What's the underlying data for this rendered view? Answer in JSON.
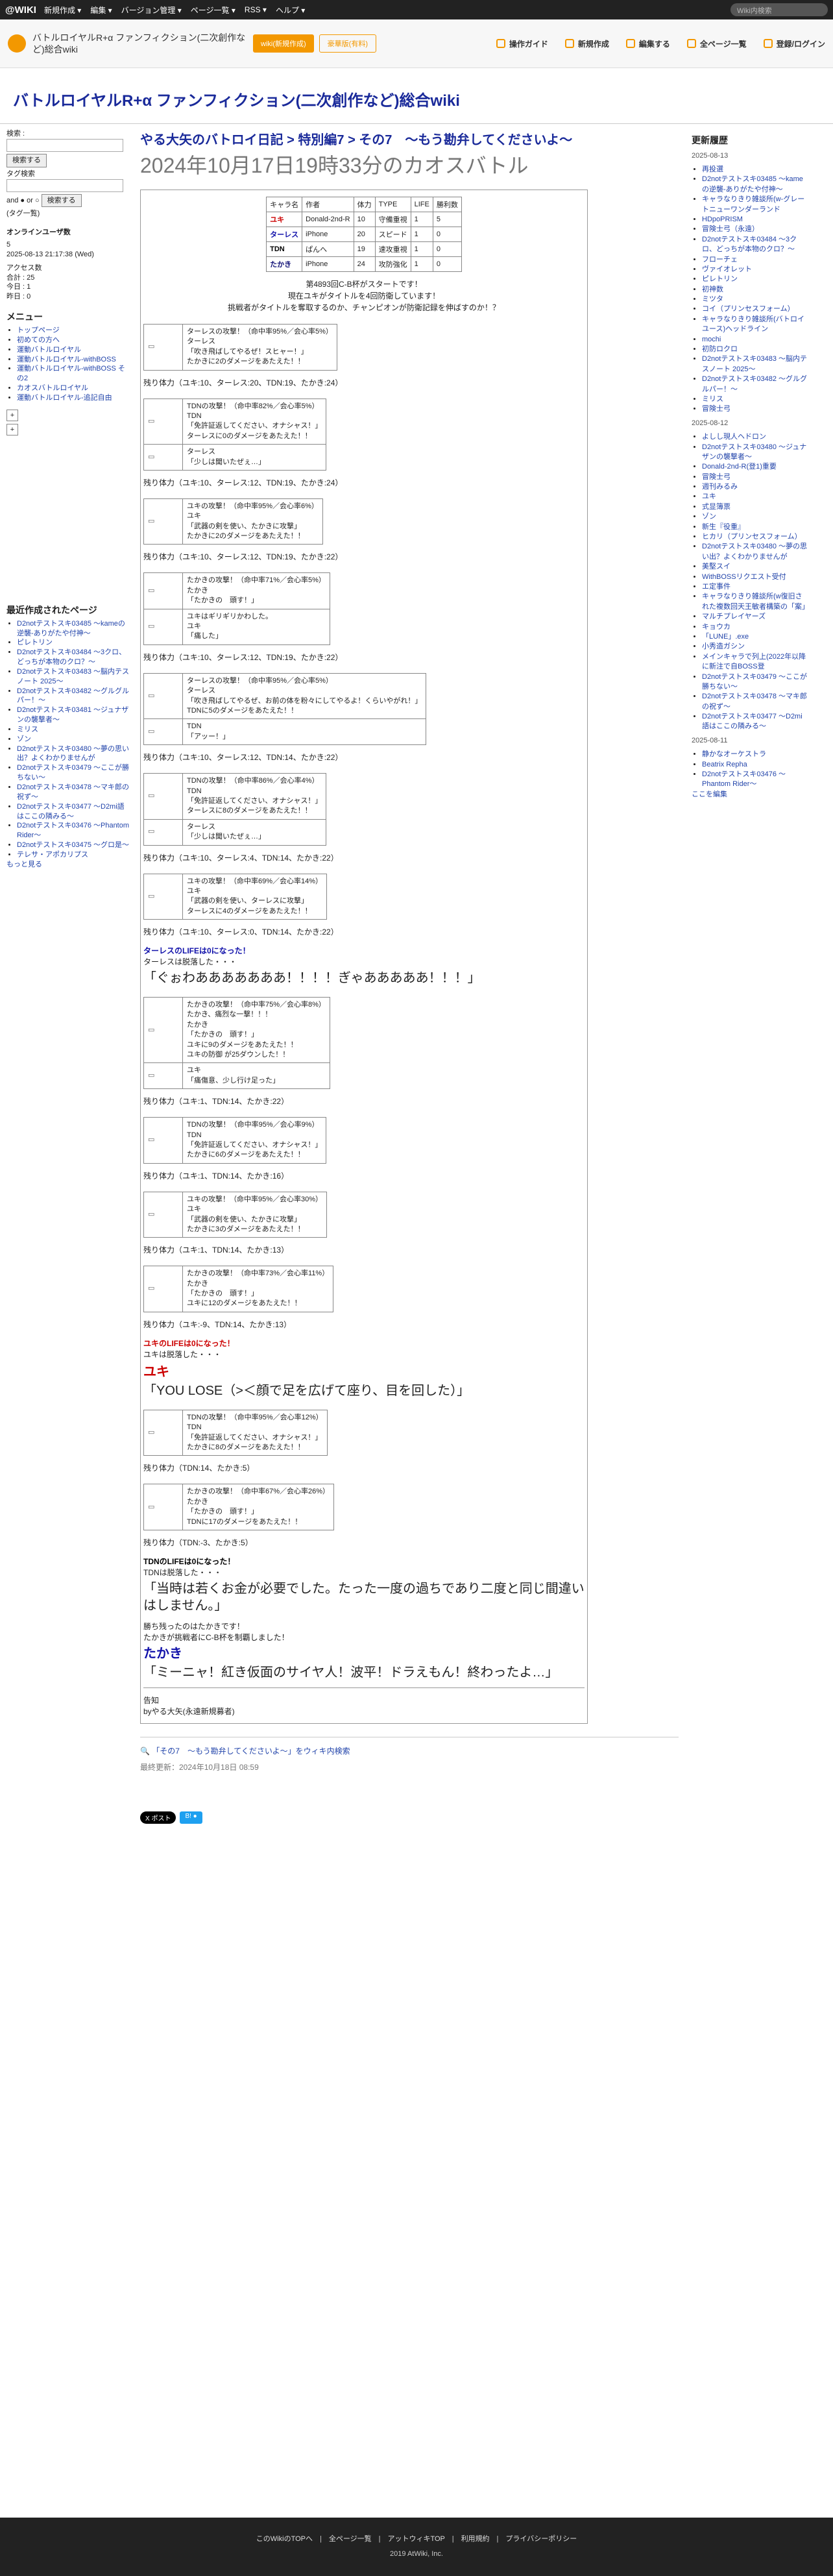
{
  "topbar": {
    "logo": "@WIKI",
    "menus": [
      "新規作成 ▾",
      "編集 ▾",
      "バージョン管理 ▾",
      "ページ一覧 ▾",
      "RSS ▾",
      "ヘルプ ▾"
    ],
    "search_placeholder": "Wiki内検索"
  },
  "sitehead": {
    "title": "バトルロイヤルR+α ファンフィクション(二次創作など)総合wiki",
    "wiki_btn": "wiki(新規作成)",
    "paid_btn": "豪華版(有料)",
    "tools": [
      "操作ガイド",
      "新規作成",
      "編集する",
      "全ページ一覧",
      "登録/ログイン"
    ]
  },
  "wiki_title": "バトルロイヤルR+α ファンフィクション(二次創作など)総合wiki",
  "left": {
    "search_label": "検索 :",
    "search_btn": "検索する",
    "tag_label": "タグ検索",
    "and": "and",
    "or": "or",
    "tag_btn": "検索する",
    "tag_cloud": "(タグ一覧)",
    "online": "オンラインユーザ数",
    "online_n": "5",
    "time": "2025-08-13 21:17:38 (Wed)",
    "access": "アクセス数",
    "total": "合計 : 25",
    "today": "今日 : 1",
    "yest": "昨日 : 0",
    "menu_h": "メニュー",
    "menu": [
      "トップページ",
      "初めての方へ",
      "運動バトルロイヤル",
      "運動バトルロイヤル-withBOSS",
      "運動バトルロイヤル-withBOSS その2",
      "カオスバトルロイヤル",
      "運動バトルロイヤル-追記自由"
    ],
    "recent_h": "最近作成されたページ",
    "recent": [
      "D2notテストスキ03485 〜kameの逆襲-ありがたや付神〜",
      "ピレトリン",
      "D2notテストスキ03484 〜3クロ、どっちが本物のクロ？〜",
      "D2notテストスキ03483 〜脳内テスノート 2025〜",
      "D2notテストスキ03482 〜グルグルパー！〜",
      "D2notテストスキ03481 〜ジュナザンの襲撃者〜",
      "ミリス",
      "ゾン",
      "D2notテストスキ03480 〜夢の思い出？よくわかりませんが",
      "D2notテストスキ03479 〜ここが勝ちない〜",
      "D2notテストスキ03478 〜マキ郎の祝ず〜",
      "D2notテストスキ03477 〜D2mi語はここの隣みる〜",
      "D2notテストスキ03476 〜Phantom Rider〜",
      "D2notテストスキ03475 〜グロ是〜",
      "テレサ・アポカリプス"
    ],
    "more": "もっと見る"
  },
  "breadcrumb": "やる大矢のバトロイ日記 > 特別編7 > その7　〜もう勘弁してくださいよ〜",
  "page_title": "2024年10月17日19時33分のカオスバトル",
  "status_table": {
    "headers": [
      "キャラ名",
      "作者",
      "体力",
      "TYPE",
      "LIFE",
      "勝利数"
    ],
    "rows": [
      [
        "ユキ",
        "Donald-2nd-R",
        "10",
        "守備重視",
        "1",
        "5"
      ],
      [
        "ターレス",
        "iPhone",
        "20",
        "スピード",
        "1",
        "0"
      ],
      [
        "TDN",
        "ぱんへ",
        "19",
        "速攻重視",
        "1",
        "0"
      ],
      [
        "たかき",
        "iPhone",
        "24",
        "攻防強化",
        "1",
        "0"
      ]
    ]
  },
  "intro": [
    "第4893回C-B杯がスタートです！",
    "現在ユキがタイトルを4回防衛しています！",
    "挑戦者がタイトルを奪取するのか、チャンピオンが防衛記録を伸ばすのか！？"
  ],
  "remain_label": "残り体力（",
  "rounds": [
    {
      "events": [
        {
          "text": [
            "ターレスの攻撃！（命中率95%／会心率5%）",
            "ターレス",
            "「吹き飛ばしてやるぜ！スヒャー！」",
            "たかきに2のダメージをあたえた！！"
          ]
        }
      ],
      "hp": "ユキ:10、ターレス:20、TDN:19、たかき:24"
    },
    {
      "events": [
        {
          "text": [
            "TDNの攻撃！（命中率82%／会心率5%）",
            "TDN",
            "「免許証返してください、オナシャス！」",
            "ターレスに0のダメージをあたえた！！"
          ]
        },
        {
          "text": [
            "ターレス",
            "「少しは聞いたぜぇ…」"
          ]
        }
      ],
      "hp": "ユキ:10、ターレス:12、TDN:19、たかき:24"
    },
    {
      "events": [
        {
          "text": [
            "ユキの攻撃！（命中率95%／会心率6%）",
            "ユキ",
            "「武器の剣を使い、たかきに攻撃」",
            "たかきに2のダメージをあたえた！！"
          ]
        }
      ],
      "hp": "ユキ:10、ターレス:12、TDN:19、たかき:22"
    },
    {
      "events": [
        {
          "text": [
            "たかきの攻撃！（命中率71%／会心率5%）",
            "たかき",
            "「たかきの　頭す！」"
          ]
        },
        {
          "text": [
            "ユキはギリギリかわした。",
            "ユキ",
            "「痛した」"
          ]
        }
      ],
      "hp": "ユキ:10、ターレス:12、TDN:19、たかき:22"
    },
    {
      "events": [
        {
          "text": [
            "ターレスの攻撃！（命中率95%／会心率5%）",
            "ターレス",
            "「吹き飛ばしてやるぜ、お前の体を粉々にしてやるよ！くらいやがれ！」",
            "TDNに5のダメージをあたえた！！"
          ]
        },
        {
          "text": [
            "TDN",
            "「アッー！」"
          ]
        }
      ],
      "hp": "ユキ:10、ターレス:12、TDN:14、たかき:22"
    },
    {
      "events": [
        {
          "text": [
            "TDNの攻撃！（命中率86%／会心率4%）",
            "TDN",
            "「免許証返してください、オナシャス！」",
            "ターレスに8のダメージをあたえた！！"
          ]
        },
        {
          "text": [
            "ターレス",
            "「少しは聞いたぜぇ…」"
          ]
        }
      ],
      "hp": "ユキ:10、ターレス:4、TDN:14、たかき:22"
    },
    {
      "events": [
        {
          "text": [
            "ユキの攻撃！（命中率69%／会心率14%）",
            "ユキ",
            "「武器の剣を使い、ターレスに攻撃」",
            "ターレスに4のダメージをあたえた！！"
          ]
        }
      ],
      "hp": "ユキ:10、ターレス:0、TDN:14、たかき:22"
    }
  ],
  "ko1": {
    "line1": "ターレスのLIFEは0になった！",
    "line2": "ターレスは脱落した・・・",
    "shout": "「ぐぉわあああああああ！！！！ぎゃあああああ！！！」"
  },
  "rounds2": [
    {
      "events": [
        {
          "text": [
            "たかきの攻撃！（命中率75%／会心率8%）",
            "たかき、痛烈な一撃！！！",
            "たかき",
            "「たかきの　頭す！」",
            "ユキに9のダメージをあたえた！！",
            "ユキの防御 が25ダウンした！！"
          ]
        },
        {
          "text": [
            "ユキ",
            "「痛傷意、少し行け足った」"
          ]
        }
      ],
      "hp": "ユキ:1、TDN:14、たかき:22"
    },
    {
      "events": [
        {
          "text": [
            "TDNの攻撃！（命中率95%／会心率9%）",
            "TDN",
            "「免許証返してください、オナシャス！」",
            "たかきに6のダメージをあたえた！！"
          ]
        }
      ],
      "hp": "ユキ:1、TDN:14、たかき:16"
    },
    {
      "events": [
        {
          "text": [
            "ユキの攻撃！（命中率95%／会心率30%）",
            "ユキ",
            "「武器の剣を使い、たかきに攻撃」",
            "たかきに3のダメージをあたえた！！"
          ]
        }
      ],
      "hp": "ユキ:1、TDN:14、たかき:13"
    },
    {
      "events": [
        {
          "text": [
            "たかきの攻撃！（命中率73%／会心率11%）",
            "たかき",
            "「たかきの　頭す！」",
            "ユキに12のダメージをあたえた！！"
          ]
        }
      ],
      "hp": "ユキ:-9、TDN:14、たかき:13"
    }
  ],
  "ko2": {
    "line1": "ユキのLIFEは0になった！",
    "line2": "ユキは脱落した・・・",
    "name": "ユキ",
    "shout": "「YOU LOSE（>＜顔で足を広げて座り、目を回した）」"
  },
  "rounds3": [
    {
      "events": [
        {
          "text": [
            "TDNの攻撃！（命中率95%／会心率12%）",
            "TDN",
            "「免許証返してください、オナシャス！」",
            "たかきに8のダメージをあたえた！！"
          ]
        }
      ],
      "hp": "TDN:14、たかき:5"
    },
    {
      "events": [
        {
          "text": [
            "たかきの攻撃！（命中率67%／会心率26%）",
            "たかき",
            "「たかきの　頭す！」",
            "TDNに17のダメージをあたえた！！"
          ]
        }
      ],
      "hp": "TDN:-3、たかき:5"
    }
  ],
  "ko3": {
    "line1": "TDNのLIFEは0になった！",
    "line2": "TDNは脱落した・・・",
    "shout": "「当時は若くお金が必要でした。たった一度の過ちであり二度と同じ間違いはしません。」"
  },
  "winner": {
    "line1": "勝ち残ったのはたかきです！",
    "line2": "たかきが挑戦者にC-B杯を制覇しました！",
    "name": "たかき",
    "speech": "「ミーニャ！紅き仮面のサイヤ人！波平！ドラえもん！終わったよ…」"
  },
  "closing": [
    "告知",
    "byやる大矢(永遠新規募者)"
  ],
  "page_footer": {
    "search_link": "「その7　〜もう勘弁してくださいよ〜」をウィキ内検索",
    "updated": "最終更新：2024年10月18日 08:59",
    "post_x": "X ポスト",
    "share": "B! ●"
  },
  "right": {
    "title": "更新履歴",
    "groups": [
      {
        "date": "2025-08-13",
        "items": [
          "再投選",
          "D2notテストスキ03485 〜kameの逆襲-ありがたや付神〜",
          "キャラなりきり雑談所(w-グレートニューワンダーランド",
          "HDpoPRISM",
          "冒険士弓（永遠）",
          "D2notテストスキ03484 〜3クロ、どっちが本物のクロ？〜",
          "フローチェ",
          "ヴァイオレット",
          "ピレトリン",
          "初神数",
          "ミツタ",
          "コイ（プリンセスフォーム）",
          "キャラなりきり雑談所(バトロイユース)ヘッドライン",
          "mochi",
          "初防ロクロ",
          "D2notテストスキ03483 〜脳内テスノート 2025〜",
          "D2notテストスキ03482 〜グルグルパー！〜",
          "ミリス",
          "冒険士弓"
        ]
      },
      {
        "date": "2025-08-12",
        "items": [
          "よしし現人ヘドロン",
          "D2notテストスキ03480 〜ジュナザンの襲撃者〜",
          "Donald-2nd-R(登1)重要",
          "冒険士弓",
          "週刊みるみ",
          "ユキ",
          "式显簿票",
          "ゾン",
          "新生『役重』",
          "ヒカリ（プリンセスフォーム）",
          "D2notテストスキ03480 〜夢の思い出？よくわかりませんが",
          "美堅スイ",
          "WithBOSSリクエスト受付",
          "エ定事件",
          "キャラなりきり雑談所(w復旧された複数回天王敏者構築の「案」",
          "マルチプレイヤーズ",
          "キョウカ",
          "「LUNE」.exe",
          "小秀造ガシン",
          "メインキャラで列上(2022年以降に新注で自BOSS登",
          "D2notテストスキ03479 〜ここが勝ちない〜",
          "D2notテストスキ03478 〜マキ郎の祝ず〜",
          "D2notテストスキ03477 〜D2mi語はここの隣みる〜"
        ]
      },
      {
        "date": "2025-08-11",
        "items": [
          "静かなオーケストラ",
          "Beatrix Repha",
          "D2notテストスキ03476 〜Phantom Rider〜"
        ]
      }
    ],
    "more": "ここを編集"
  },
  "footer": {
    "links": [
      "このWikiのTOPへ",
      "全ページ一覧",
      "アットウィキTOP",
      "利用規約",
      "プライバシーポリシー"
    ],
    "copy": "2019 AtWiki, Inc."
  }
}
